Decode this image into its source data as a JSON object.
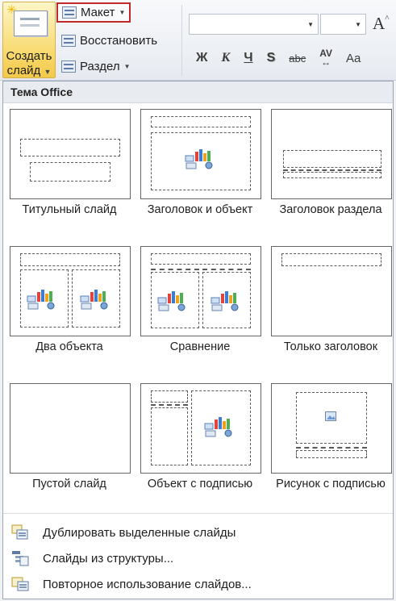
{
  "ribbon": {
    "new_slide": {
      "line1": "Создать",
      "line2": "слайд"
    },
    "layout_label": "Макет",
    "reset_label": "Восстановить",
    "section_label": "Раздел",
    "font_name": "",
    "font_size": "",
    "formatting": {
      "bold": "Ж",
      "italic": "К",
      "underline": "Ч",
      "shadow": "S",
      "strike": "abc",
      "spacing": "AV",
      "case": "Aa"
    }
  },
  "gallery": {
    "header": "Тема Office",
    "layouts": [
      {
        "label": "Титульный слайд"
      },
      {
        "label": "Заголовок и объект"
      },
      {
        "label": "Заголовок раздела"
      },
      {
        "label": "Два объекта"
      },
      {
        "label": "Сравнение"
      },
      {
        "label": "Только заголовок"
      },
      {
        "label": "Пустой слайд"
      },
      {
        "label": "Объект с подписью"
      },
      {
        "label": "Рисунок с подписью"
      }
    ],
    "actions": [
      {
        "label": "Дублировать выделенные слайды"
      },
      {
        "label": "Слайды из структуры..."
      },
      {
        "label": "Повторное использование слайдов..."
      }
    ]
  },
  "colors": {
    "highlight_border": "#c0282a",
    "new_slide_fill": "#f7d86a"
  }
}
